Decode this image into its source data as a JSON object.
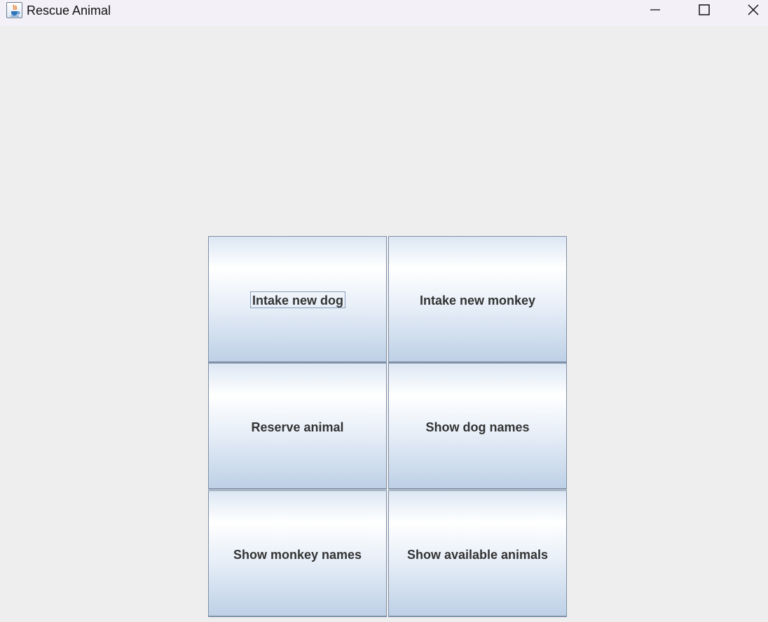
{
  "window": {
    "title": "Rescue Animal",
    "icon": "java-cup-icon",
    "controls": [
      "minimize-icon",
      "maximize-icon",
      "close-icon"
    ]
  },
  "buttons": [
    {
      "label": "Intake new dog",
      "focused": true
    },
    {
      "label": "Intake new monkey",
      "focused": false
    },
    {
      "label": "Reserve animal",
      "focused": false
    },
    {
      "label": "Show dog names",
      "focused": false
    },
    {
      "label": "Show monkey names",
      "focused": false
    },
    {
      "label": "Show available animals",
      "focused": false
    }
  ],
  "colors": {
    "background": "#eeeeee",
    "titlebar": "#f3f1f7",
    "button_text": "#333333",
    "button_border": "#7d8ea6",
    "button_gradient_top": "#ffffff",
    "button_gradient_bottom": "#bdd0e6"
  }
}
